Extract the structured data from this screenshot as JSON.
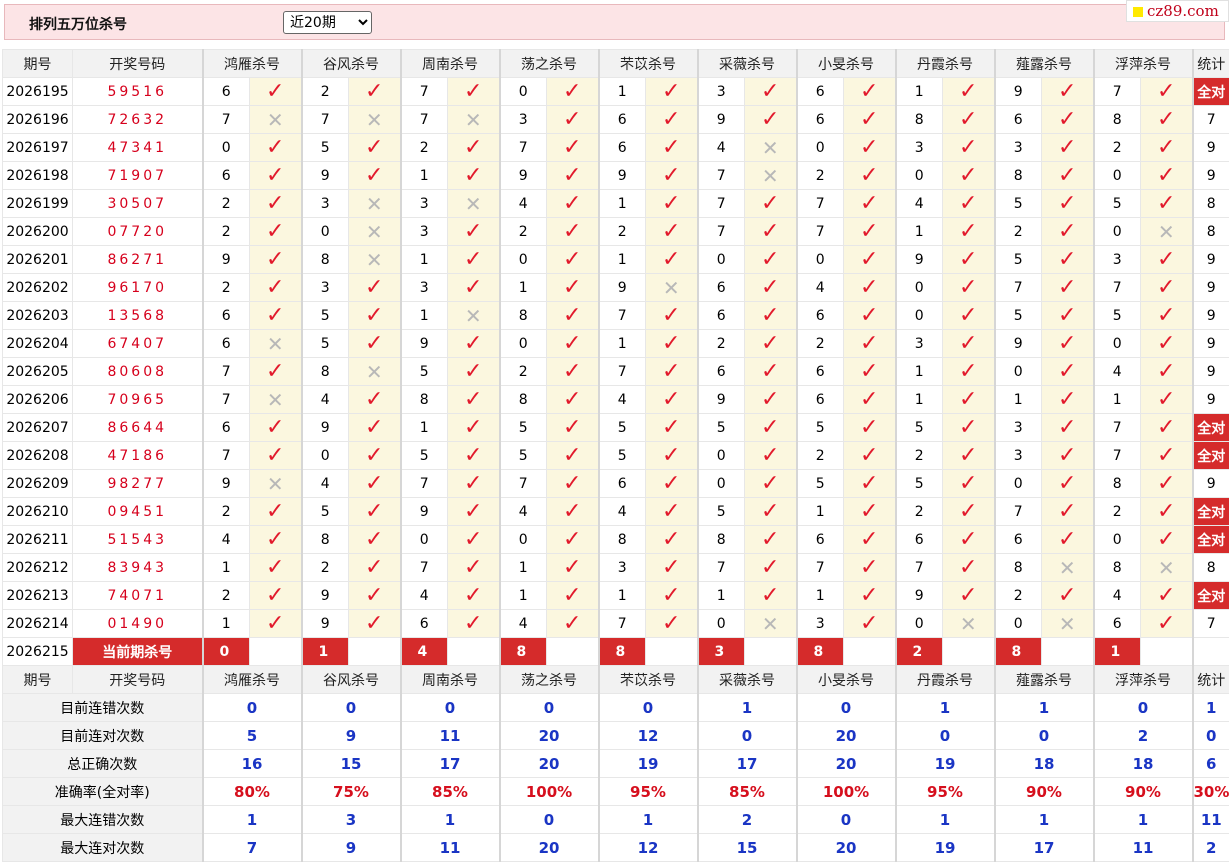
{
  "header": {
    "title": "排列五万位杀号",
    "range_selected": "近20期"
  },
  "brand": {
    "text": "cz89.com"
  },
  "columns": {
    "period": "期号",
    "draw": "开奖号码",
    "experts": [
      "鸿雁杀号",
      "谷风杀号",
      "周南杀号",
      "荡之杀号",
      "芣苡杀号",
      "采薇杀号",
      "小旻杀号",
      "丹霞杀号",
      "薤露杀号",
      "浮萍杀号"
    ],
    "stat": "统计"
  },
  "rows": [
    {
      "period": "2026195",
      "draw": "59516",
      "kills": [
        6,
        2,
        7,
        0,
        1,
        3,
        6,
        1,
        9,
        7
      ],
      "ok": [
        1,
        1,
        1,
        1,
        1,
        1,
        1,
        1,
        1,
        1
      ],
      "stat": "全对"
    },
    {
      "period": "2026196",
      "draw": "72632",
      "kills": [
        7,
        7,
        7,
        3,
        6,
        9,
        6,
        8,
        6,
        8
      ],
      "ok": [
        0,
        0,
        0,
        1,
        1,
        1,
        1,
        1,
        1,
        1
      ],
      "stat": "7"
    },
    {
      "period": "2026197",
      "draw": "47341",
      "kills": [
        0,
        5,
        2,
        7,
        6,
        4,
        0,
        3,
        3,
        2
      ],
      "ok": [
        1,
        1,
        1,
        1,
        1,
        0,
        1,
        1,
        1,
        1
      ],
      "stat": "9"
    },
    {
      "period": "2026198",
      "draw": "71907",
      "kills": [
        6,
        9,
        1,
        9,
        9,
        7,
        2,
        0,
        8,
        0
      ],
      "ok": [
        1,
        1,
        1,
        1,
        1,
        0,
        1,
        1,
        1,
        1
      ],
      "stat": "9"
    },
    {
      "period": "2026199",
      "draw": "30507",
      "kills": [
        2,
        3,
        3,
        4,
        1,
        7,
        7,
        4,
        5,
        5
      ],
      "ok": [
        1,
        0,
        0,
        1,
        1,
        1,
        1,
        1,
        1,
        1
      ],
      "stat": "8"
    },
    {
      "period": "2026200",
      "draw": "07720",
      "kills": [
        2,
        0,
        3,
        2,
        2,
        7,
        7,
        1,
        2,
        0
      ],
      "ok": [
        1,
        0,
        1,
        1,
        1,
        1,
        1,
        1,
        1,
        0
      ],
      "stat": "8"
    },
    {
      "period": "2026201",
      "draw": "86271",
      "kills": [
        9,
        8,
        1,
        0,
        1,
        0,
        0,
        9,
        5,
        3
      ],
      "ok": [
        1,
        0,
        1,
        1,
        1,
        1,
        1,
        1,
        1,
        1
      ],
      "stat": "9"
    },
    {
      "period": "2026202",
      "draw": "96170",
      "kills": [
        2,
        3,
        3,
        1,
        9,
        6,
        4,
        0,
        7,
        7
      ],
      "ok": [
        1,
        1,
        1,
        1,
        0,
        1,
        1,
        1,
        1,
        1
      ],
      "stat": "9"
    },
    {
      "period": "2026203",
      "draw": "13568",
      "kills": [
        6,
        5,
        1,
        8,
        7,
        6,
        6,
        0,
        5,
        5
      ],
      "ok": [
        1,
        1,
        0,
        1,
        1,
        1,
        1,
        1,
        1,
        1
      ],
      "stat": "9"
    },
    {
      "period": "2026204",
      "draw": "67407",
      "kills": [
        6,
        5,
        9,
        0,
        1,
        2,
        2,
        3,
        9,
        0
      ],
      "ok": [
        0,
        1,
        1,
        1,
        1,
        1,
        1,
        1,
        1,
        1
      ],
      "stat": "9"
    },
    {
      "period": "2026205",
      "draw": "80608",
      "kills": [
        7,
        8,
        5,
        2,
        7,
        6,
        6,
        1,
        0,
        4
      ],
      "ok": [
        1,
        0,
        1,
        1,
        1,
        1,
        1,
        1,
        1,
        1
      ],
      "stat": "9"
    },
    {
      "period": "2026206",
      "draw": "70965",
      "kills": [
        7,
        4,
        8,
        8,
        4,
        9,
        6,
        1,
        1,
        1
      ],
      "ok": [
        0,
        1,
        1,
        1,
        1,
        1,
        1,
        1,
        1,
        1
      ],
      "stat": "9"
    },
    {
      "period": "2026207",
      "draw": "86644",
      "kills": [
        6,
        9,
        1,
        5,
        5,
        5,
        5,
        5,
        3,
        7
      ],
      "ok": [
        1,
        1,
        1,
        1,
        1,
        1,
        1,
        1,
        1,
        1
      ],
      "stat": "全对"
    },
    {
      "period": "2026208",
      "draw": "47186",
      "kills": [
        7,
        0,
        5,
        5,
        5,
        0,
        2,
        2,
        3,
        7
      ],
      "ok": [
        1,
        1,
        1,
        1,
        1,
        1,
        1,
        1,
        1,
        1
      ],
      "stat": "全对"
    },
    {
      "period": "2026209",
      "draw": "98277",
      "kills": [
        9,
        4,
        7,
        7,
        6,
        0,
        5,
        5,
        0,
        8
      ],
      "ok": [
        0,
        1,
        1,
        1,
        1,
        1,
        1,
        1,
        1,
        1
      ],
      "stat": "9"
    },
    {
      "period": "2026210",
      "draw": "09451",
      "kills": [
        2,
        5,
        9,
        4,
        4,
        5,
        1,
        2,
        7,
        2
      ],
      "ok": [
        1,
        1,
        1,
        1,
        1,
        1,
        1,
        1,
        1,
        1
      ],
      "stat": "全对"
    },
    {
      "period": "2026211",
      "draw": "51543",
      "kills": [
        4,
        8,
        0,
        0,
        8,
        8,
        6,
        6,
        6,
        0
      ],
      "ok": [
        1,
        1,
        1,
        1,
        1,
        1,
        1,
        1,
        1,
        1
      ],
      "stat": "全对"
    },
    {
      "period": "2026212",
      "draw": "83943",
      "kills": [
        1,
        2,
        7,
        1,
        3,
        7,
        7,
        7,
        8,
        8
      ],
      "ok": [
        1,
        1,
        1,
        1,
        1,
        1,
        1,
        1,
        0,
        0
      ],
      "stat": "8"
    },
    {
      "period": "2026213",
      "draw": "74071",
      "kills": [
        2,
        9,
        4,
        1,
        1,
        1,
        1,
        9,
        2,
        4
      ],
      "ok": [
        1,
        1,
        1,
        1,
        1,
        1,
        1,
        1,
        1,
        1
      ],
      "stat": "全对"
    },
    {
      "period": "2026214",
      "draw": "01490",
      "kills": [
        1,
        9,
        6,
        4,
        7,
        0,
        3,
        0,
        0,
        6
      ],
      "ok": [
        1,
        1,
        1,
        1,
        1,
        0,
        1,
        0,
        0,
        1
      ],
      "stat": "7"
    }
  ],
  "current": {
    "period": "2026215",
    "label": "当前期杀号",
    "kills": [
      0,
      1,
      4,
      8,
      8,
      3,
      8,
      2,
      8,
      1
    ]
  },
  "summary": [
    {
      "label": "目前连错次数",
      "values": [
        "0",
        "0",
        "0",
        "0",
        "0",
        "1",
        "0",
        "1",
        "1",
        "0"
      ],
      "stat": "1",
      "red": false
    },
    {
      "label": "目前连对次数",
      "values": [
        "5",
        "9",
        "11",
        "20",
        "12",
        "0",
        "20",
        "0",
        "0",
        "2"
      ],
      "stat": "0",
      "red": false
    },
    {
      "label": "总正确次数",
      "values": [
        "16",
        "15",
        "17",
        "20",
        "19",
        "17",
        "20",
        "19",
        "18",
        "18"
      ],
      "stat": "6",
      "red": false
    },
    {
      "label": "准确率(全对率)",
      "values": [
        "80%",
        "75%",
        "85%",
        "100%",
        "95%",
        "85%",
        "100%",
        "95%",
        "90%",
        "90%"
      ],
      "stat": "30%",
      "red": true
    },
    {
      "label": "最大连错次数",
      "values": [
        "1",
        "3",
        "1",
        "0",
        "1",
        "2",
        "0",
        "1",
        "1",
        "1"
      ],
      "stat": "11",
      "red": false
    },
    {
      "label": "最大连对次数",
      "values": [
        "7",
        "9",
        "11",
        "20",
        "12",
        "15",
        "20",
        "19",
        "17",
        "11"
      ],
      "stat": "2",
      "red": false
    }
  ],
  "symbols": {
    "correct": "✓",
    "wrong": "✕"
  },
  "colors": {
    "accent_red": "#d52b2b",
    "tick_red": "#e21a2c",
    "summary_blue": "#1a35c4",
    "header_pink": "#fce4e6",
    "mark_bg": "#fbf7df"
  }
}
